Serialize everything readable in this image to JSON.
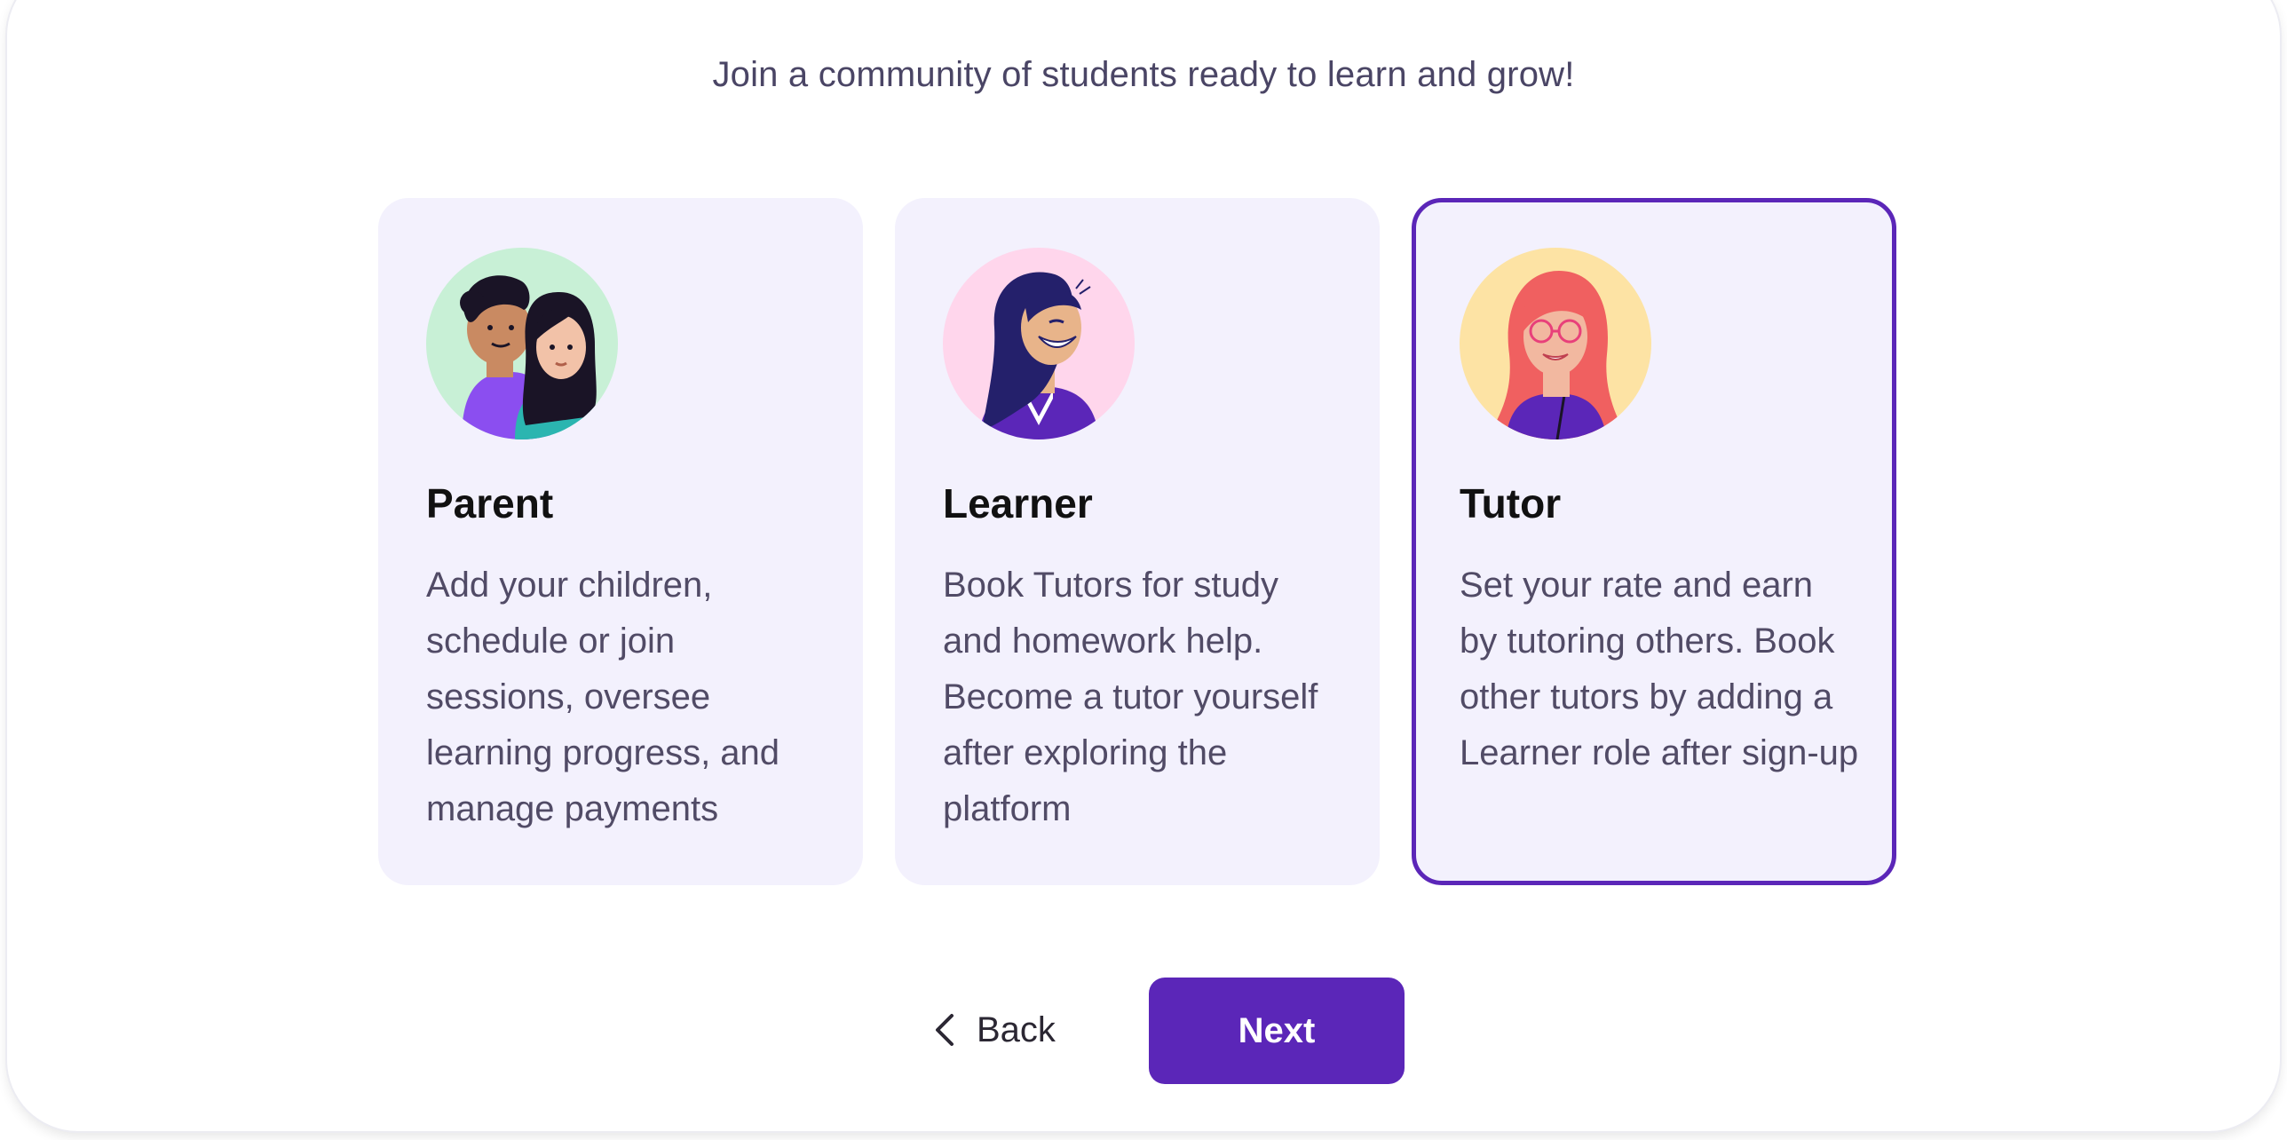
{
  "subtitle": "Join a community of students ready to learn and grow!",
  "roles": [
    {
      "title": "Parent",
      "description": "Add your children, schedule or join sessions, oversee learning progress, and manage payments",
      "avatar_icon": "parent-illustration",
      "selected": false
    },
    {
      "title": "Learner",
      "description": "Book Tutors for study and homework help. Become a tutor yourself after exploring the platform",
      "avatar_icon": "learner-illustration",
      "selected": false
    },
    {
      "title": "Tutor",
      "description": "Set your rate and earn by tutoring others. Book other tutors by adding a Learner role after sign-up",
      "avatar_icon": "tutor-illustration",
      "selected": true
    }
  ],
  "nav": {
    "back_label": "Back",
    "back_icon": "chevron-left-icon",
    "next_label": "Next"
  },
  "colors": {
    "accent": "#5b26b8",
    "card_bg": "#f3f1fd",
    "parent_avatar_bg": "#c8f0d6",
    "learner_avatar_bg": "#ffd6ec",
    "tutor_avatar_bg": "#fde3a4"
  }
}
